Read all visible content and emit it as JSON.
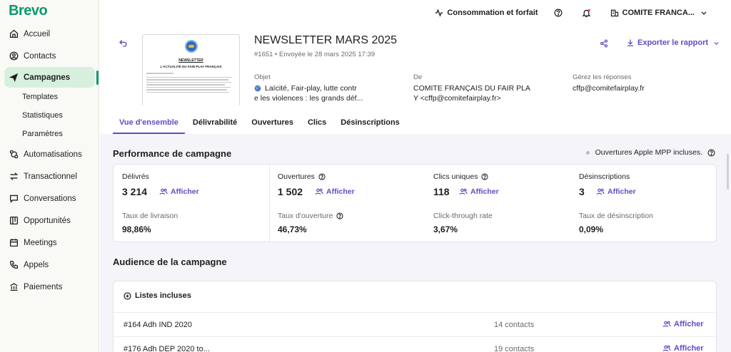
{
  "brand": {
    "logo": "Brevo",
    "accent": "#0b996e",
    "link_color": "#5b4fc4"
  },
  "sidebar": {
    "items": [
      {
        "label": "Accueil",
        "icon": "home-icon"
      },
      {
        "label": "Contacts",
        "icon": "contacts-icon"
      },
      {
        "label": "Campagnes",
        "icon": "send-icon",
        "active": true
      },
      {
        "label": "Automatisations",
        "icon": "automation-icon"
      },
      {
        "label": "Transactionnel",
        "icon": "transfer-icon"
      },
      {
        "label": "Conversations",
        "icon": "chat-icon"
      },
      {
        "label": "Opportunités",
        "icon": "board-icon"
      },
      {
        "label": "Meetings",
        "icon": "calendar-icon"
      },
      {
        "label": "Appels",
        "icon": "phone-icon"
      },
      {
        "label": "Paiements",
        "icon": "bank-icon"
      }
    ],
    "sub_items": [
      "Templates",
      "Statistiques",
      "Paramètres"
    ]
  },
  "topbar": {
    "usage": "Consommation et forfait",
    "account": "COMITE FRANCA..."
  },
  "campaign": {
    "title": "NEWSLETTER MARS 2025",
    "meta": "#1651 • Envoyée le 28 mars 2025 17:39",
    "export": "Exporter le rapport",
    "preview": {
      "title": "NEWSLETTER",
      "subtitle": "L'ACTUALITÉ DU FAIR-PLAY FRANÇAIS"
    },
    "objet_label": "Objet",
    "objet_line1": "Laïcité, Fair-play, lutte contr",
    "objet_line2": "e les violences : les grands déf...",
    "de_label": "De",
    "de_line1": "COMITE FRANÇAIS DU FAIR PLA",
    "de_line2": "Y <cffp@comitefairplay.fr>",
    "reply_label": "Gérez les réponses",
    "reply_value": "cffp@comitefairplay.fr"
  },
  "tabs": [
    "Vue d'ensemble",
    "Délivrabilité",
    "Ouvertures",
    "Clics",
    "Désinscriptions"
  ],
  "performance": {
    "title": "Performance de campagne",
    "mpp_note": "Ouvertures Apple MPP incluses.",
    "link_label": "Afficher",
    "cols": [
      {
        "label": "Délivrés",
        "value": "3 214",
        "sublabel": "Taux de livraison",
        "subvalue": "98,86%"
      },
      {
        "label": "Ouvertures",
        "value": "1 502",
        "sublabel": "Taux d'ouverture",
        "subvalue": "46,73%"
      },
      {
        "label": "Clics uniques",
        "value": "118",
        "sublabel": "Click-through rate",
        "subvalue": "3,67%"
      },
      {
        "label": "Désinscriptions",
        "value": "3",
        "sublabel": "Taux de désinscription",
        "subvalue": "0,09%"
      }
    ]
  },
  "audience": {
    "title": "Audience de la campagne",
    "lists_label": "Listes incluses",
    "link_label": "Afficher",
    "rows": [
      {
        "name": "#164 Adh IND 2020",
        "count": "14 contacts"
      },
      {
        "name": "#176 Adh DEP 2020 to...",
        "count": "19 contacts"
      }
    ]
  }
}
